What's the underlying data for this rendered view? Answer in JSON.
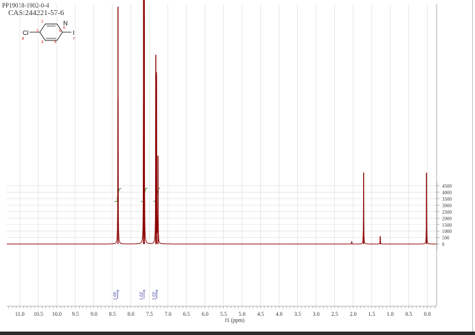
{
  "header": {
    "sample_id": "PP19018-1902-0-4",
    "cas": "CAS:244221-57-6"
  },
  "structure": {
    "atoms": [
      "N",
      "Cl",
      "I"
    ],
    "numbers": [
      "1",
      "2",
      "3",
      "4",
      "5",
      "6",
      "7",
      "8"
    ]
  },
  "chart_data": {
    "type": "line",
    "title": "",
    "xlabel": "f1 (ppm)",
    "ylabel": "",
    "xlim": [
      11.35,
      -0.25
    ],
    "ylim": [
      -480,
      1850
    ],
    "x_reversed": true,
    "grid": true,
    "x_ticks": [
      "11.0",
      "10.5",
      "10.0",
      "9.5",
      "9.0",
      "8.5",
      "8.0",
      "7.5",
      "7.0",
      "6.5",
      "6.0",
      "5.5",
      "5.0",
      "4.5",
      "4.0",
      "3.5",
      "3.0",
      "2.5",
      "2.0",
      "1.5",
      "1.0",
      "0.5",
      "0.0"
    ],
    "y_ticks": [
      "4500",
      "4000",
      "3500",
      "3000",
      "2500",
      "2000",
      "1500",
      "1000",
      "500",
      "0"
    ],
    "y_tick_values": [
      4500,
      4000,
      3500,
      3000,
      2500,
      2000,
      1500,
      1000,
      500,
      0
    ],
    "integration_scale": 10,
    "peaks": [
      {
        "x": 8.35,
        "y": 1830
      },
      {
        "x": 7.66,
        "y": 1900
      },
      {
        "x": 7.64,
        "y": 2120
      },
      {
        "x": 7.33,
        "y": 1460
      },
      {
        "x": 7.31,
        "y": 1300
      },
      {
        "x": 7.27,
        "y": 680
      },
      {
        "x": 2.04,
        "y": 20
      },
      {
        "x": 1.72,
        "y": 550
      },
      {
        "x": 1.27,
        "y": 60
      },
      {
        "x": 0.02,
        "y": 550
      }
    ],
    "integrals": [
      {
        "from": 8.43,
        "to": 8.28,
        "y0": 3280,
        "y1": 4290,
        "label": "1.00"
      },
      {
        "from": 7.72,
        "to": 7.57,
        "y0": 3280,
        "y1": 4310,
        "label": "1.02"
      },
      {
        "from": 7.38,
        "to": 7.23,
        "y0": 3290,
        "y1": 4310,
        "label": "1.02"
      }
    ],
    "colors": {
      "spectrum": "#8b0000",
      "integral": "#2e8b2e",
      "integral_label": "#2d2d9a",
      "atom_number": "#d40000",
      "grid": "#d9d9d9",
      "text": "#333333"
    }
  }
}
